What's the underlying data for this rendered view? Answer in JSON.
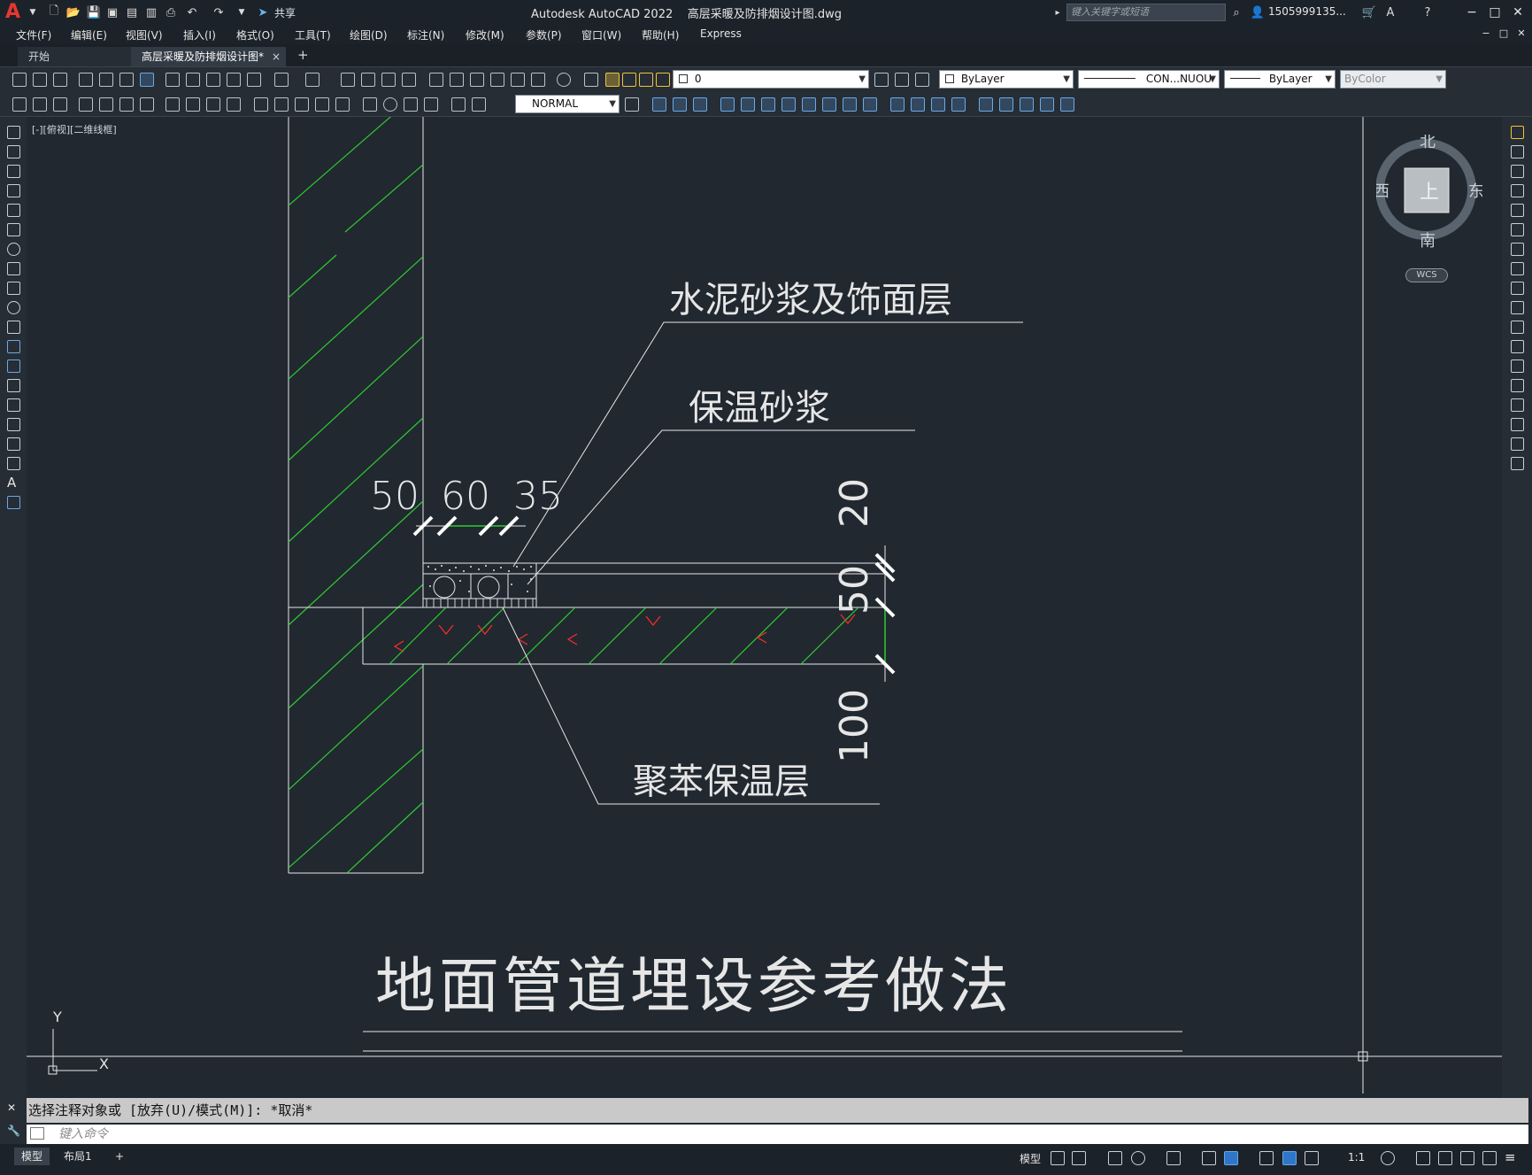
{
  "window": {
    "app_logo": "A",
    "title": "Autodesk AutoCAD 2022    高层采暖及防排烟设计图.dwg",
    "share_label": "共享",
    "search_placeholder": "键入关键字或短语",
    "user": "1505999135...",
    "controls": [
      "−",
      "□",
      "✕"
    ]
  },
  "menu": [
    "文件(F)",
    "编辑(E)",
    "视图(V)",
    "插入(I)",
    "格式(O)",
    "工具(T)",
    "绘图(D)",
    "标注(N)",
    "修改(M)",
    "参数(P)",
    "窗口(W)",
    "帮助(H)",
    "Express"
  ],
  "tabs": [
    {
      "label": "开始"
    },
    {
      "label": "高层采暖及防排烟设计图*"
    }
  ],
  "tab_close": "×",
  "tab_add": "+",
  "properties": {
    "layer": "0",
    "color": "ByLayer",
    "linetype": "CON...NUOU",
    "lineweight": "ByLayer",
    "plotstyle": "ByColor",
    "textstyle": "NORMAL"
  },
  "viewport_label": "[-][俯视][二维线框]",
  "viewcube": {
    "north": "北",
    "south": "南",
    "east": "东",
    "west": "西",
    "face": "上",
    "ucs": "WCS"
  },
  "drawing": {
    "label_cement": "水泥砂浆及饰面层",
    "label_mortar": "保温砂浆",
    "label_foam": "聚苯保温层",
    "dim_50": "50",
    "dim_60": "60",
    "dim_35": "35",
    "dim_20": "20",
    "dim_50v": "50",
    "dim_100": "100",
    "title": "地面管道埋设参考做法",
    "ucs_y": "Y",
    "ucs_x": "X"
  },
  "command": {
    "history": "选择注释对象或 [放弃(U)/模式(M)]: *取消*",
    "placeholder": "键入命令"
  },
  "status": {
    "layout_tabs": [
      "模型",
      "布局1"
    ],
    "add": "+",
    "model": "模型",
    "scale": "1:1"
  },
  "colors": {
    "hatch": "#2ecc2e",
    "marker": "#ff2b2b",
    "lines": "#ffffff",
    "background": "#212830"
  }
}
